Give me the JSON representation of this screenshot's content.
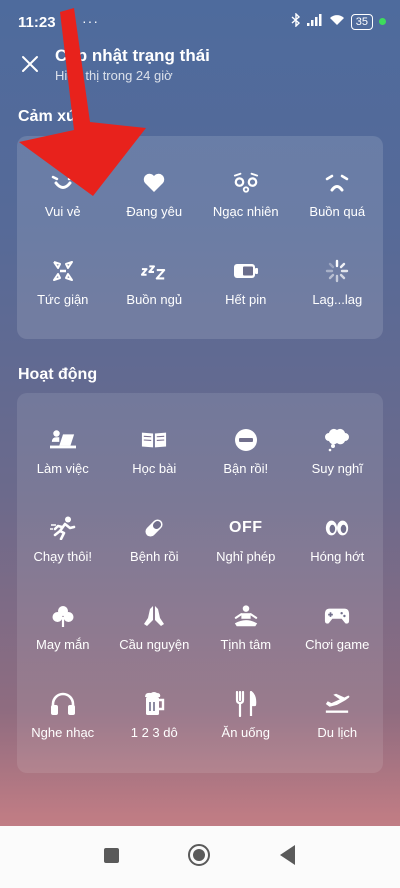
{
  "status_bar": {
    "time": "11:23",
    "more": "···",
    "battery": "35"
  },
  "header": {
    "title": "Cập nhật trạng thái",
    "subtitle": "Hiển thị trong 24 giờ"
  },
  "emotions": {
    "title": "Cảm xúc",
    "items": [
      {
        "label": "Vui vẻ",
        "icon": "smile-icon"
      },
      {
        "label": "Đang yêu",
        "icon": "heart-icon"
      },
      {
        "label": "Ngạc nhiên",
        "icon": "surprised-icon"
      },
      {
        "label": "Buồn quá",
        "icon": "sad-icon"
      },
      {
        "label": "Tức giận",
        "icon": "angry-icon"
      },
      {
        "label": "Buồn ngủ",
        "icon": "sleepy-icon"
      },
      {
        "label": "Hết pin",
        "icon": "battery-low-icon"
      },
      {
        "label": "Lag...lag",
        "icon": "loading-icon"
      }
    ]
  },
  "activities": {
    "title": "Hoạt động",
    "items": [
      {
        "label": "Làm việc",
        "icon": "laptop-work-icon"
      },
      {
        "label": "Học bài",
        "icon": "book-icon"
      },
      {
        "label": "Bận rồi!",
        "icon": "busy-icon"
      },
      {
        "label": "Suy nghĩ",
        "icon": "thought-bubble-icon"
      },
      {
        "label": "Chạy thôi!",
        "icon": "running-icon"
      },
      {
        "label": "Bệnh rồi",
        "icon": "pill-icon"
      },
      {
        "label": "Nghỉ phép",
        "icon": "off-icon",
        "icon_text": "OFF"
      },
      {
        "label": "Hóng hớt",
        "icon": "eyes-icon"
      },
      {
        "label": "May mắn",
        "icon": "clover-icon"
      },
      {
        "label": "Cầu nguyện",
        "icon": "praying-hands-icon"
      },
      {
        "label": "Tịnh tâm",
        "icon": "meditation-icon"
      },
      {
        "label": "Chơi game",
        "icon": "gamepad-icon"
      },
      {
        "label": "Nghe nhạc",
        "icon": "headphones-icon"
      },
      {
        "label": "1 2 3 dô",
        "icon": "beer-icon"
      },
      {
        "label": "Ăn uống",
        "icon": "fork-knife-icon"
      },
      {
        "label": "Du lịch",
        "icon": "airplane-icon"
      }
    ]
  },
  "colors": {
    "accent_arrow": "#e8221c",
    "nav_bar": "#fbfbfb"
  }
}
